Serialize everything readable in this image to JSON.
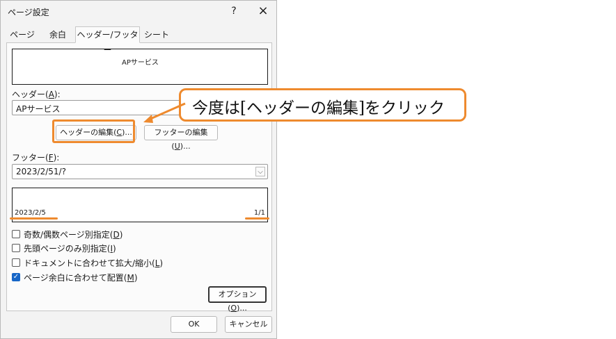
{
  "window": {
    "title": "ページ設定",
    "help_icon": "?",
    "close_icon": "×"
  },
  "tabs": [
    {
      "label": "ページ",
      "active": false
    },
    {
      "label": "余白",
      "active": false
    },
    {
      "label": "ヘッダー/フッター",
      "active": true
    },
    {
      "label": "シート",
      "active": false
    }
  ],
  "header": {
    "preview_text": "APサービス",
    "label_prefix": "ヘッダー(",
    "label_key": "A",
    "label_suffix": "):",
    "selected_value": "APサービス"
  },
  "buttons": {
    "edit_header_prefix": "ヘッダーの編集(",
    "edit_header_key": "C",
    "edit_header_suffix": ")...",
    "edit_footer_prefix": "フッターの編集(",
    "edit_footer_key": "U",
    "edit_footer_suffix": ")...",
    "options_prefix": "オプション(",
    "options_key": "O",
    "options_suffix": ")...",
    "ok": "OK",
    "cancel": "キャンセル"
  },
  "footer": {
    "label_prefix": "フッター(",
    "label_key": "F",
    "label_suffix": "):",
    "selected_value": "2023/2/51/?",
    "preview_left": "2023/2/5",
    "preview_right": "1/1"
  },
  "checkboxes": [
    {
      "label_prefix": "奇数/偶数ページ別指定(",
      "key": "D",
      "label_suffix": ")",
      "checked": false
    },
    {
      "label_prefix": "先頭ページのみ別指定(",
      "key": "I",
      "label_suffix": ")",
      "checked": false
    },
    {
      "label_prefix": "ドキュメントに合わせて拡大/縮小(",
      "key": "L",
      "label_suffix": ")",
      "checked": false
    },
    {
      "label_prefix": "ページ余白に合わせて配置(",
      "key": "M",
      "label_suffix": ")",
      "checked": true
    }
  ],
  "annotation": {
    "callout_text": "今度は[ヘッダーの編集]をクリック",
    "accent_color": "#ee8a2e"
  },
  "icons": {
    "dropdown": "chevron-down-icon",
    "check": "checkmark-icon"
  },
  "glyphs": {
    "chevron": "⌵",
    "check": "✓"
  }
}
